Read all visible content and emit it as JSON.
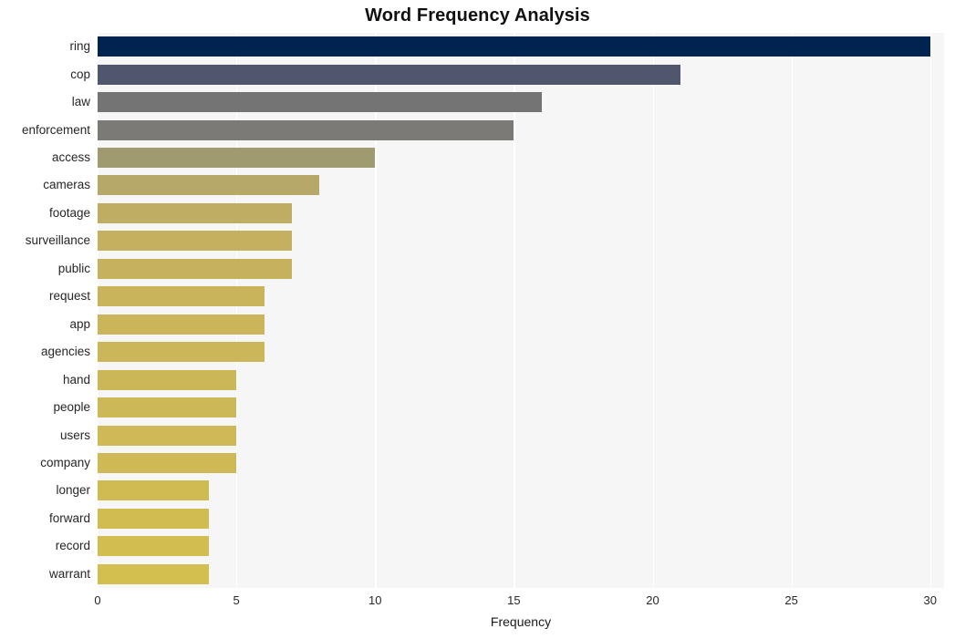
{
  "chart_data": {
    "type": "bar",
    "orientation": "horizontal",
    "title": "Word Frequency Analysis",
    "xlabel": "Frequency",
    "ylabel": "",
    "xlim": [
      0,
      30.5
    ],
    "xticks": [
      0,
      5,
      10,
      15,
      20,
      25,
      30
    ],
    "xtick_labels": [
      "0",
      "5",
      "10",
      "15",
      "20",
      "25",
      "30"
    ],
    "grid": true,
    "grid_axis": "x",
    "legend": false,
    "categories": [
      "ring",
      "cop",
      "law",
      "enforcement",
      "access",
      "cameras",
      "footage",
      "surveillance",
      "public",
      "request",
      "app",
      "agencies",
      "hand",
      "people",
      "users",
      "company",
      "longer",
      "forward",
      "record",
      "warrant"
    ],
    "values": [
      30,
      21,
      16,
      15,
      10,
      8,
      7,
      7,
      7,
      6,
      6,
      6,
      5,
      5,
      5,
      5,
      4,
      4,
      4,
      4
    ],
    "bar_colors": [
      "#002350",
      "#4f566e",
      "#737473",
      "#7c7a77",
      "#a09a71",
      "#b5a869",
      "#bfad63",
      "#c4b05f",
      "#c6b25e",
      "#c9b45c",
      "#cbb55b",
      "#cbb65a",
      "#ccb758",
      "#cdb857",
      "#ceb956",
      "#ceb955",
      "#d0bb53",
      "#d1bc52",
      "#d2bd51",
      "#d3be50"
    ],
    "plot_background": "#f6f6f7",
    "figure_background": "#ffffff",
    "gridline_color": "#ffffff",
    "text_color": "#262626"
  }
}
